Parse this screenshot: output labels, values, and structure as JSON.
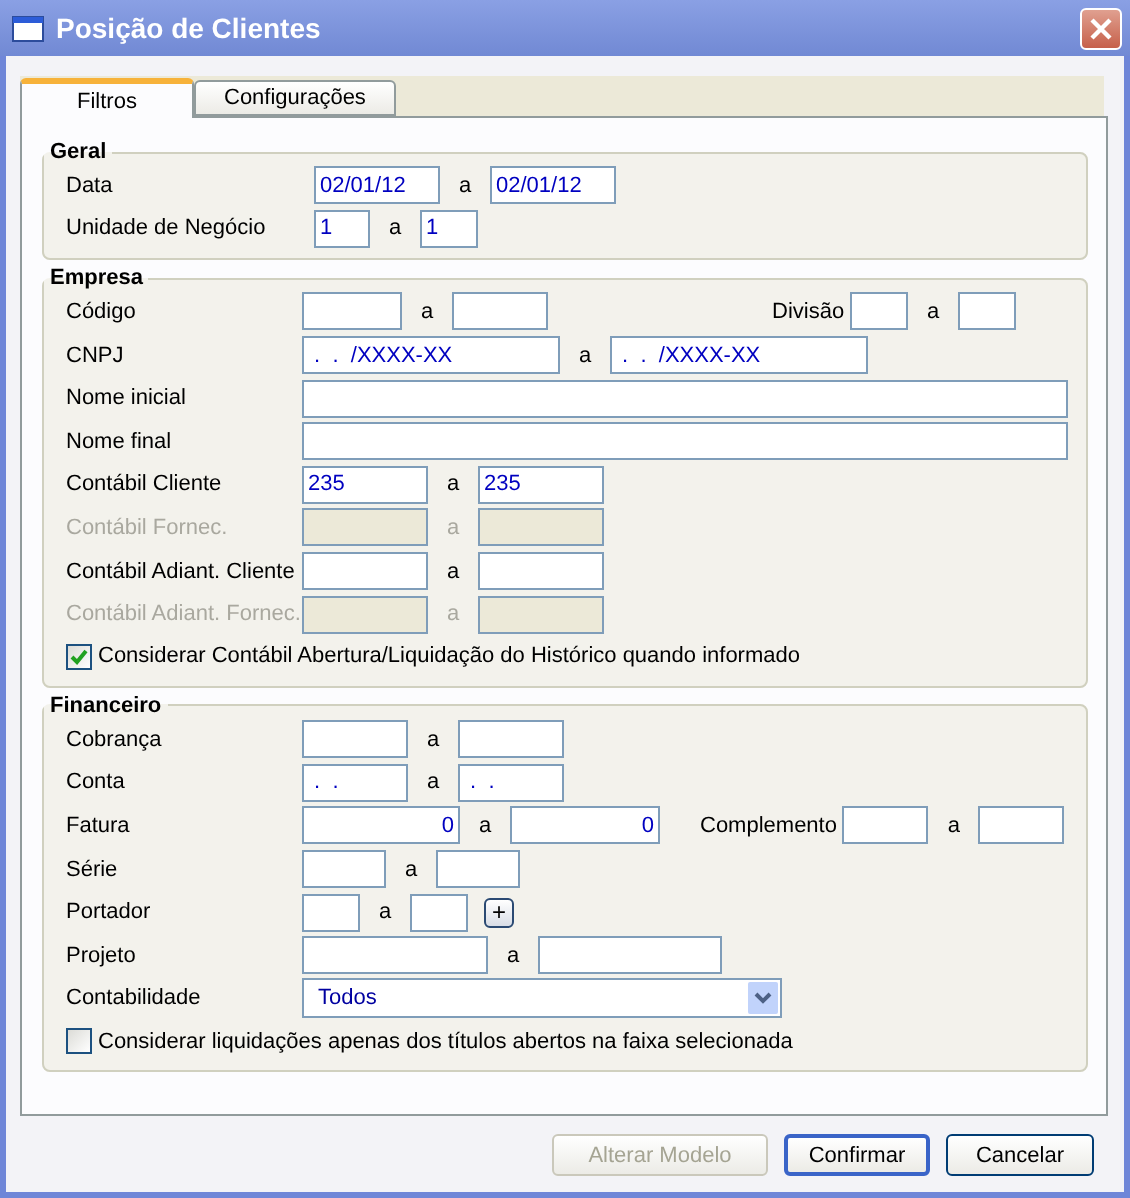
{
  "window": {
    "title": "Posição de Clientes"
  },
  "tabs": [
    {
      "label": "Filtros",
      "selected": true
    },
    {
      "label": "Configurações",
      "selected": false
    }
  ],
  "groups": [
    {
      "title": "Geral",
      "rows": [
        {
          "kind": "fields",
          "label": "Data",
          "disabled": false,
          "items": [
            {
              "kind": "field",
              "value": "02/01/12"
            },
            {
              "kind": "text",
              "text": "a"
            },
            {
              "kind": "field",
              "value": "02/01/12"
            }
          ]
        },
        {
          "kind": "fields",
          "label": "Unidade de Negócio",
          "disabled": false,
          "items": [
            {
              "kind": "field",
              "value": "1"
            },
            {
              "kind": "text",
              "text": "a"
            },
            {
              "kind": "field",
              "value": "1"
            }
          ]
        }
      ]
    },
    {
      "title": "Empresa",
      "rows": [
        {
          "kind": "fields",
          "label": "Código",
          "disabled": false,
          "items": [
            {
              "kind": "field"
            },
            {
              "kind": "text",
              "text": "a"
            },
            {
              "kind": "field"
            },
            {
              "kind": "label",
              "text": "Divisão"
            },
            {
              "kind": "field"
            },
            {
              "kind": "text",
              "text": "a"
            },
            {
              "kind": "field"
            }
          ]
        },
        {
          "kind": "fields",
          "label": "CNPJ",
          "disabled": false,
          "items": [
            {
              "kind": "field",
              "value": " .  .  /XXXX-XX"
            },
            {
              "kind": "text",
              "text": "a"
            },
            {
              "kind": "field",
              "value": " .  .  /XXXX-XX"
            }
          ]
        },
        {
          "kind": "fields",
          "label": "Nome inicial",
          "disabled": false,
          "items": [
            {
              "kind": "field"
            }
          ]
        },
        {
          "kind": "fields",
          "label": "Nome final",
          "disabled": false,
          "items": [
            {
              "kind": "field"
            }
          ]
        },
        {
          "kind": "fields",
          "label": "Contábil Cliente",
          "disabled": false,
          "items": [
            {
              "kind": "field",
              "value": "235"
            },
            {
              "kind": "text",
              "text": "a"
            },
            {
              "kind": "field",
              "value": "235"
            }
          ]
        },
        {
          "kind": "fields",
          "label": "Contábil Fornec.",
          "disabled": true,
          "items": [
            {
              "kind": "field"
            },
            {
              "kind": "text",
              "text": "a"
            },
            {
              "kind": "field"
            }
          ]
        },
        {
          "kind": "fields",
          "label": "Contábil Adiant. Cliente",
          "disabled": false,
          "items": [
            {
              "kind": "field"
            },
            {
              "kind": "text",
              "text": "a"
            },
            {
              "kind": "field"
            }
          ]
        },
        {
          "kind": "fields",
          "label": "Contábil Adiant. Fornec.",
          "disabled": true,
          "items": [
            {
              "kind": "field"
            },
            {
              "kind": "text",
              "text": "a"
            },
            {
              "kind": "field"
            }
          ]
        },
        {
          "kind": "checkbox",
          "label": "Considerar Contábil Abertura/Liquidação do Histórico quando informado",
          "checked": true
        }
      ]
    },
    {
      "title": "Financeiro",
      "rows": [
        {
          "kind": "fields",
          "label": "Cobrança",
          "disabled": false,
          "items": [
            {
              "kind": "field"
            },
            {
              "kind": "text",
              "text": "a"
            },
            {
              "kind": "field"
            }
          ]
        },
        {
          "kind": "fields",
          "label": "Conta",
          "disabled": false,
          "items": [
            {
              "kind": "field",
              "value": " .  ."
            },
            {
              "kind": "text",
              "text": "a"
            },
            {
              "kind": "field",
              "value": " .  ."
            }
          ]
        },
        {
          "kind": "fields",
          "label": "Fatura",
          "disabled": false,
          "items": [
            {
              "kind": "number",
              "value": "0"
            },
            {
              "kind": "text",
              "text": "a"
            },
            {
              "kind": "number",
              "value": "0"
            },
            {
              "kind": "label",
              "text": "Complemento"
            },
            {
              "kind": "field"
            },
            {
              "kind": "text",
              "text": "a"
            },
            {
              "kind": "field"
            }
          ]
        },
        {
          "kind": "fields",
          "label": "Série",
          "disabled": false,
          "items": [
            {
              "kind": "field"
            },
            {
              "kind": "text",
              "text": "a"
            },
            {
              "kind": "field"
            }
          ]
        },
        {
          "kind": "fields",
          "label": "Portador",
          "disabled": false,
          "items": [
            {
              "kind": "field"
            },
            {
              "kind": "text",
              "text": "a"
            },
            {
              "kind": "field"
            },
            {
              "kind": "add",
              "text": "+"
            }
          ]
        },
        {
          "kind": "fields",
          "label": "Projeto",
          "disabled": false,
          "items": [
            {
              "kind": "field"
            },
            {
              "kind": "text",
              "text": "a"
            },
            {
              "kind": "field"
            }
          ]
        },
        {
          "kind": "fields",
          "label": "Contabilidade",
          "disabled": false,
          "items": [
            {
              "kind": "select",
              "value": "Todos"
            }
          ]
        },
        {
          "kind": "checkbox",
          "label": "Considerar liquidações apenas dos títulos abertos na faixa selecionada",
          "checked": false
        }
      ]
    }
  ],
  "buttons": [
    {
      "label": "Alterar Modelo",
      "disabled": true,
      "default": false
    },
    {
      "label": "Confirmar",
      "disabled": false,
      "default": true
    },
    {
      "label": "Cancelar",
      "disabled": false,
      "default": false
    }
  ]
}
